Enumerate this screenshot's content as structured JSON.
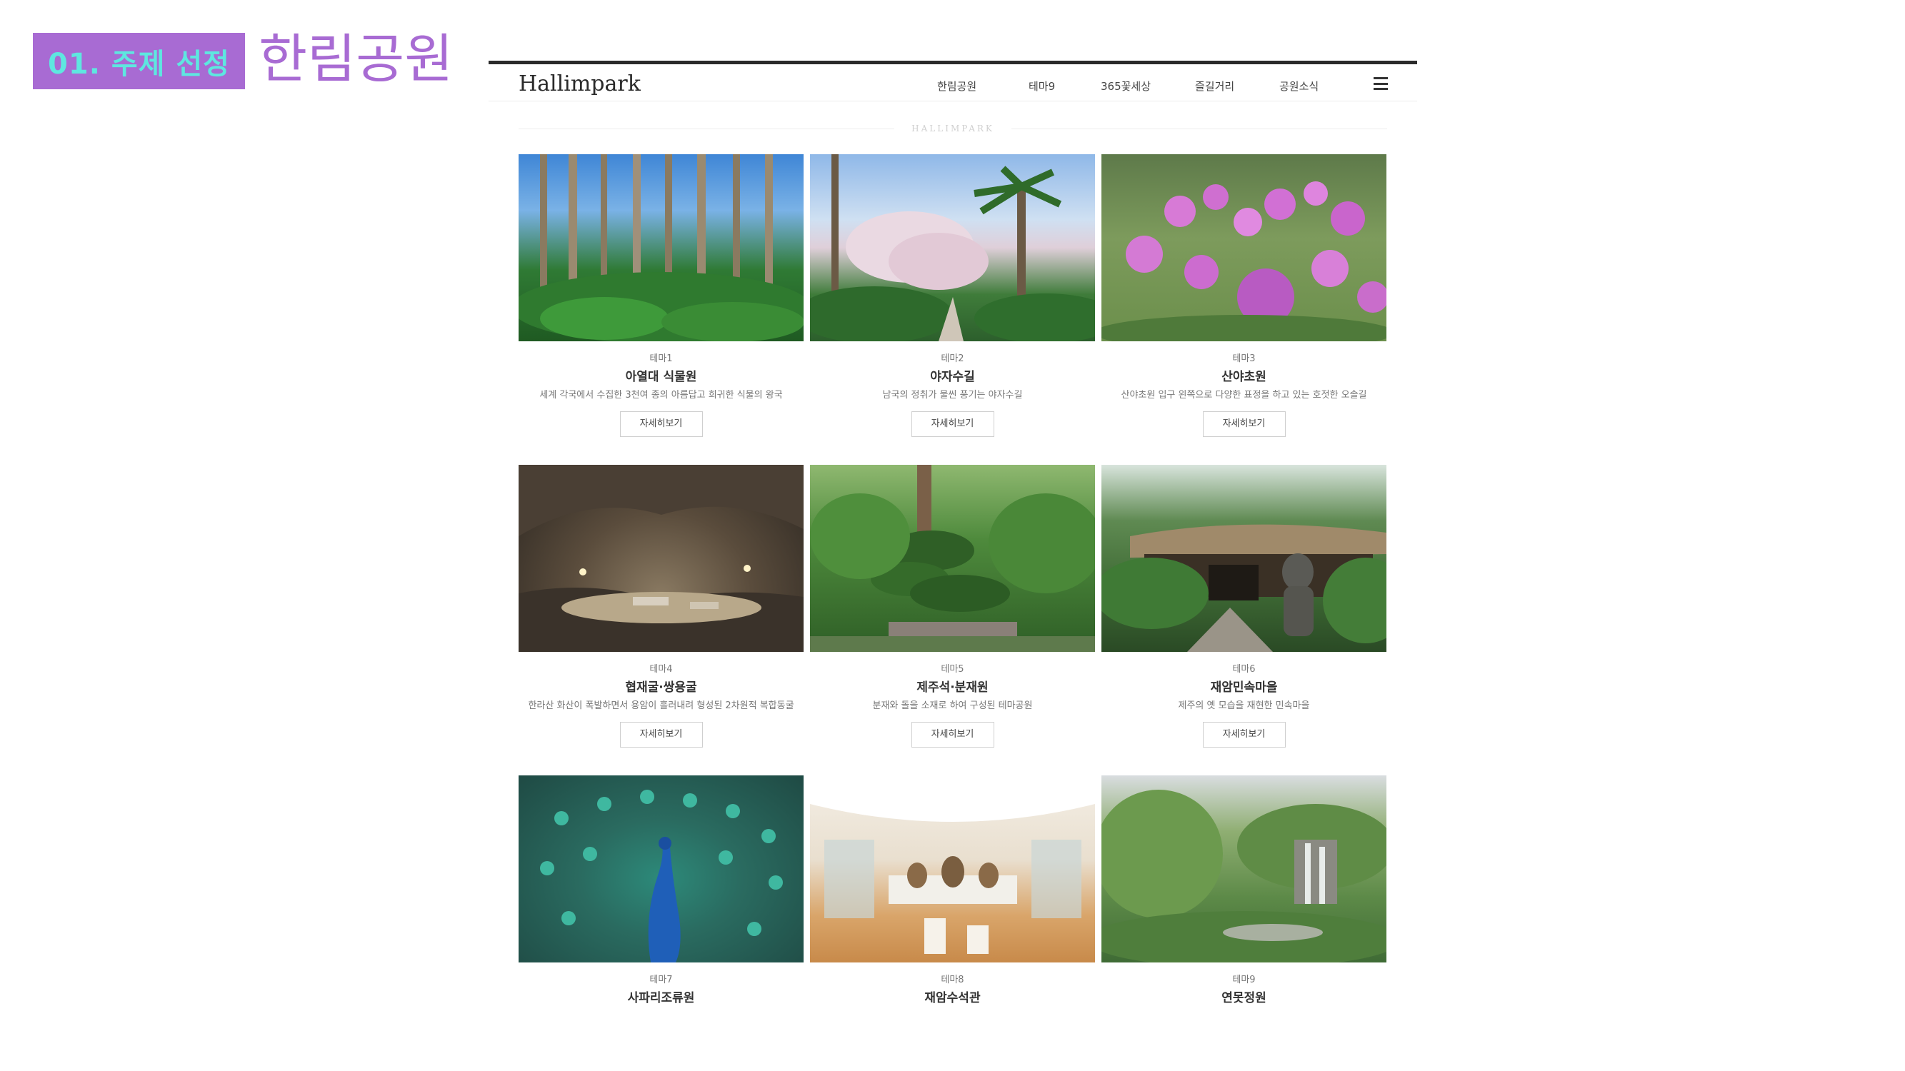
{
  "slide": {
    "badge": "01. 주제 선정",
    "title": "한림공원"
  },
  "site": {
    "logo": "Hallimpark",
    "nav": [
      "한림공원",
      "테마9",
      "365꽃세상",
      "즐길거리",
      "공원소식"
    ],
    "menu_icon": "hamburger-menu-icon",
    "section_label": "HALLIMPARK",
    "more_label": "자세히보기",
    "cards": [
      {
        "theme": "테마1",
        "title": "아열대 식물원",
        "desc": "세계 각국에서 수집한 3천여 종의 아름답고 희귀한 식물의 왕국",
        "image": "palm-tree-garden-photo"
      },
      {
        "theme": "테마2",
        "title": "야자수길",
        "desc": "남국의 정취가 물씬 풍기는 야자수길",
        "image": "palm-avenue-cherry-blossom-photo"
      },
      {
        "theme": "테마3",
        "title": "산야초원",
        "desc": "산야초원 입구 왼쪽으로 다양한 표정을 하고 있는 호젓한 오솔길",
        "image": "purple-allium-flowers-photo"
      },
      {
        "theme": "테마4",
        "title": "협재굴·쌍용굴",
        "desc": "한라산 화산이 폭발하면서 용암이 흘러내려 형성된 2차원적 복합동굴",
        "image": "lava-cave-photo"
      },
      {
        "theme": "테마5",
        "title": "제주석·분재원",
        "desc": "분재와 돌을 소재로 하여 구성된 테마공원",
        "image": "bonsai-garden-photo"
      },
      {
        "theme": "테마6",
        "title": "재암민속마을",
        "desc": "제주의 옛 모습을 재현한 민속마을",
        "image": "folk-village-stone-statue-photo"
      },
      {
        "theme": "테마7",
        "title": "사파리조류원",
        "desc": "",
        "image": "peacock-photo"
      },
      {
        "theme": "테마8",
        "title": "재암수석관",
        "desc": "",
        "image": "stone-exhibition-hall-photo"
      },
      {
        "theme": "테마9",
        "title": "연못정원",
        "desc": "",
        "image": "pond-garden-waterfall-photo"
      }
    ]
  }
}
